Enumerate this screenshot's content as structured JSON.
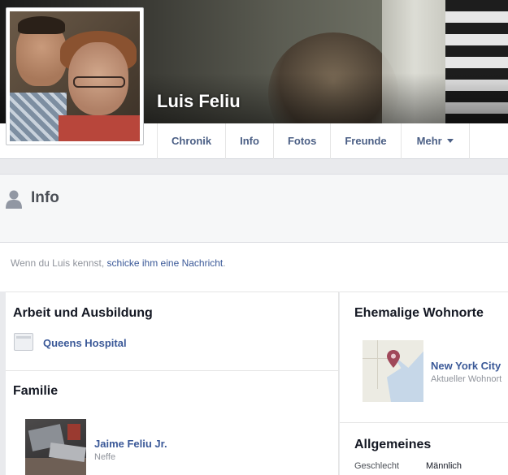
{
  "profile": {
    "name": "Luis Feliu"
  },
  "nav": {
    "tabs": [
      {
        "label": "Chronik"
      },
      {
        "label": "Info"
      },
      {
        "label": "Fotos"
      },
      {
        "label": "Freunde"
      },
      {
        "label": "Mehr"
      }
    ]
  },
  "info": {
    "title": "Info",
    "hint_prefix": "Wenn du Luis kennst,",
    "hint_link": "schicke ihm eine Nachricht",
    "hint_suffix": "."
  },
  "work": {
    "title": "Arbeit und Ausbildung",
    "items": [
      {
        "name": "Queens Hospital",
        "icon": "building-icon"
      }
    ]
  },
  "family": {
    "title": "Familie",
    "members": [
      {
        "name": "Jaime Feliu Jr.",
        "relation": "Neffe"
      }
    ]
  },
  "places": {
    "title": "Ehemalige Wohnorte",
    "items": [
      {
        "city": "New York City",
        "label": "Aktueller Wohnort",
        "icon": "map-pin-icon"
      }
    ]
  },
  "general": {
    "title": "Allgemeines",
    "rows": [
      {
        "label": "Geschlecht",
        "value": "Männlich"
      }
    ]
  },
  "colors": {
    "link": "#3b5998",
    "nav_text": "#4b5f85",
    "pin": "#a0485a"
  }
}
